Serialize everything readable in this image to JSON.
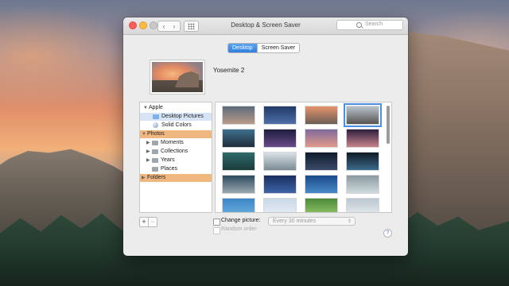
{
  "window": {
    "title": "Desktop & Screen Saver"
  },
  "toolbar": {
    "back_label": "‹",
    "forward_label": "›",
    "search_placeholder": "Search"
  },
  "tabs": [
    {
      "label": "Desktop",
      "selected": true
    },
    {
      "label": "Screen Saver",
      "selected": false
    }
  ],
  "current_wallpaper": {
    "name": "Yosemite 2"
  },
  "sidebar": {
    "groups": [
      {
        "label": "Apple",
        "expanded": true,
        "items": [
          {
            "label": "Desktop Pictures",
            "icon": "folder-icon",
            "selected": true
          },
          {
            "label": "Solid Colors",
            "icon": "color-ball-icon",
            "selected": false
          }
        ]
      },
      {
        "label": "Photos",
        "expanded": true,
        "items": [
          {
            "label": "Moments",
            "icon": "folder-icon"
          },
          {
            "label": "Collections",
            "icon": "folder-icon"
          },
          {
            "label": "Years",
            "icon": "folder-icon"
          },
          {
            "label": "Places",
            "icon": "folder-icon"
          }
        ]
      },
      {
        "label": "Folders",
        "expanded": false,
        "items": []
      }
    ]
  },
  "thumbnails": [
    {
      "name": "wallpaper-1",
      "colors": [
        "#5c6b7a",
        "#b99a88"
      ]
    },
    {
      "name": "wallpaper-2",
      "colors": [
        "#203a66",
        "#4f6fa8"
      ]
    },
    {
      "name": "wallpaper-3",
      "colors": [
        "#e6946c",
        "#6b5e56"
      ]
    },
    {
      "name": "wallpaper-4",
      "colors": [
        "#b8c4d0",
        "#5a5650"
      ],
      "selected": true
    },
    {
      "name": "wallpaper-5",
      "colors": [
        "#3e6f8f",
        "#1e2e3a"
      ]
    },
    {
      "name": "wallpaper-6",
      "colors": [
        "#1d1d3d",
        "#6a4a8a"
      ]
    },
    {
      "name": "wallpaper-7",
      "colors": [
        "#7e6a9c",
        "#e29a8a"
      ]
    },
    {
      "name": "wallpaper-8",
      "colors": [
        "#2e1e3e",
        "#c8848a"
      ]
    },
    {
      "name": "wallpaper-9",
      "colors": [
        "#2f6b6a",
        "#1a3c3a"
      ]
    },
    {
      "name": "wallpaper-10",
      "colors": [
        "#d9e2e6",
        "#7a8a94"
      ]
    },
    {
      "name": "wallpaper-11",
      "colors": [
        "#101a2a",
        "#3a4a6a"
      ]
    },
    {
      "name": "wallpaper-12",
      "colors": [
        "#0f1a24",
        "#3a6a8a"
      ]
    },
    {
      "name": "wallpaper-13",
      "colors": [
        "#2c4a5e",
        "#9aa8b0"
      ]
    },
    {
      "name": "wallpaper-14",
      "colors": [
        "#1a2e60",
        "#3e64a6"
      ]
    },
    {
      "name": "wallpaper-15",
      "colors": [
        "#1a4a8a",
        "#4a8ac8"
      ]
    },
    {
      "name": "wallpaper-16",
      "colors": [
        "#8a9aa0",
        "#d0dadc"
      ]
    },
    {
      "name": "wallpaper-17",
      "colors": [
        "#3e86c6",
        "#6ab0e0"
      ]
    },
    {
      "name": "wallpaper-18",
      "colors": [
        "#c8d8e8",
        "#e8eef4"
      ]
    },
    {
      "name": "wallpaper-19",
      "colors": [
        "#4a8a3a",
        "#9ac86a"
      ]
    },
    {
      "name": "wallpaper-20",
      "colors": [
        "#bac8d0",
        "#e6ecee"
      ]
    },
    {
      "name": "wallpaper-21",
      "colors": [
        "#3aa0c8",
        "#8ad0e8"
      ]
    },
    {
      "name": "wallpaper-22",
      "colors": [
        "#cfd8dc",
        "#f0f2f2"
      ]
    },
    {
      "name": "wallpaper-23",
      "colors": [
        "#d8d0c0",
        "#f2ece0"
      ]
    },
    {
      "name": "wallpaper-24",
      "colors": [
        "#9ab8c4",
        "#d8e4e8"
      ]
    }
  ],
  "bottom": {
    "add_label": "+",
    "remove_label": "−",
    "change_picture_label": "Change picture:",
    "interval_value": "Every 30 minutes",
    "random_order_label": "Random order",
    "help_label": "?"
  },
  "colors": {
    "accent": "#2f7fe0",
    "sidebar_group": "#f0b781",
    "selection": "#d6e4f5"
  }
}
